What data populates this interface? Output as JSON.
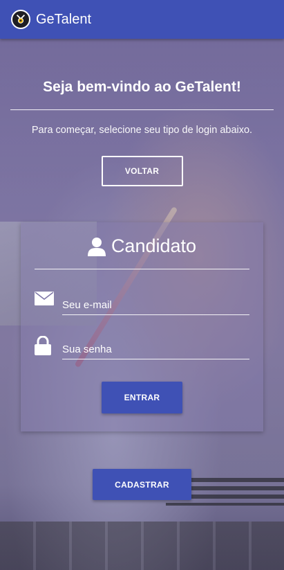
{
  "appbar": {
    "title": "GeTalent",
    "logo_icon": "helmet-logo-icon",
    "color": "#3f51b5"
  },
  "intro": {
    "welcome": "Seja bem-vindo ao GeTalent!",
    "subtitle": "Para começar, selecione seu tipo de login abaixo.",
    "back_label": "VOLTAR"
  },
  "login_card": {
    "title": "Candidato",
    "title_icon": "user-icon",
    "email": {
      "icon": "envelope-icon",
      "placeholder": "Seu e-mail",
      "value": ""
    },
    "password": {
      "icon": "lock-icon",
      "placeholder": "Sua senha",
      "value": ""
    },
    "submit_label": "ENTRAR"
  },
  "register_label": "CADASTRAR"
}
